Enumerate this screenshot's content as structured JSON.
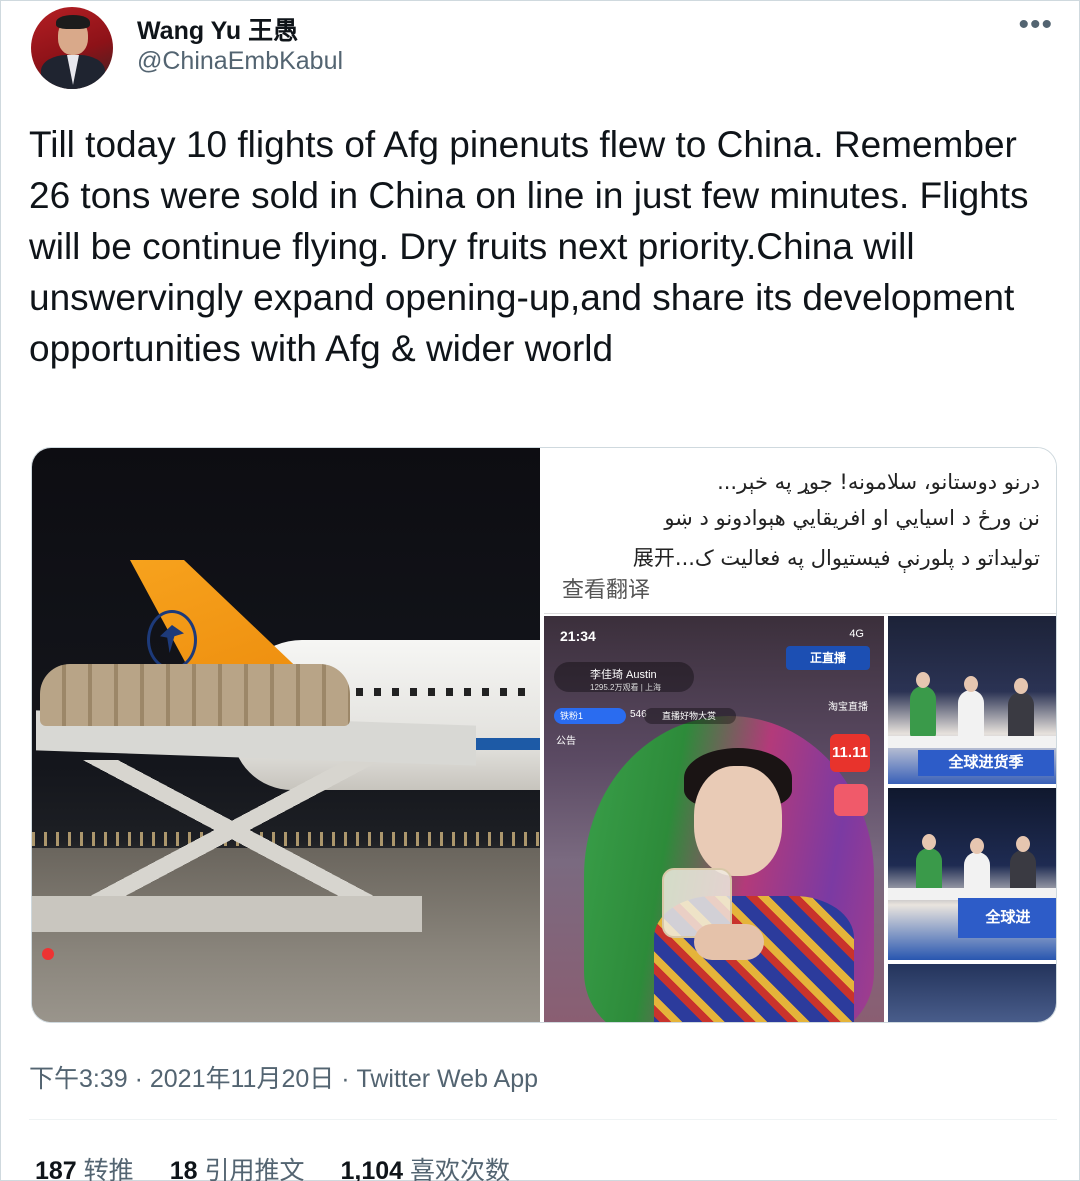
{
  "author": {
    "display_name": "Wang Yu 王愚",
    "handle": "@ChinaEmbKabul"
  },
  "more_icon": "more-horizontal-icon",
  "tweet": {
    "text": "Till today 10 flights of Afg pinenuts flew to China. Remember 26 tons were sold in China on line in just few minutes. Flights will be continue flying. Dry fruits next priority.China will unswervingly expand opening-up,and share its development opportunities with Afg & wider world"
  },
  "media": {
    "screenshot_text": {
      "line1": "درنو دوستانو، سلامونه! جوړ په خېر...",
      "line2": "نن ورځ د اسیایي او افریقایي هېوادونو د ښو",
      "line3": "تولیداتو د پلورنې فیستیوال په فعالیت ک...展开",
      "translate_label": "查看翻译"
    },
    "live": {
      "time": "21:34",
      "signal": "4G",
      "host_name": "李佳琦 Austin",
      "host_stats": "1295.2万观看 | 上海",
      "brand": "正直播",
      "taobao": "淘宝直播",
      "fans": "铁粉1",
      "count": "546",
      "tag": "直播好物大赏",
      "notice": "公告",
      "badge": "11.11"
    },
    "studio": {
      "banner1": "全球进货季",
      "banner2": "全球进"
    }
  },
  "meta": {
    "timestamp": "下午3:39 · 2021年11月20日 · Twitter Web App"
  },
  "stats": [
    {
      "num": "187",
      "label": "转推"
    },
    {
      "num": "18",
      "label": "引用推文"
    },
    {
      "num": "1,104",
      "label": "喜欢次数"
    }
  ]
}
